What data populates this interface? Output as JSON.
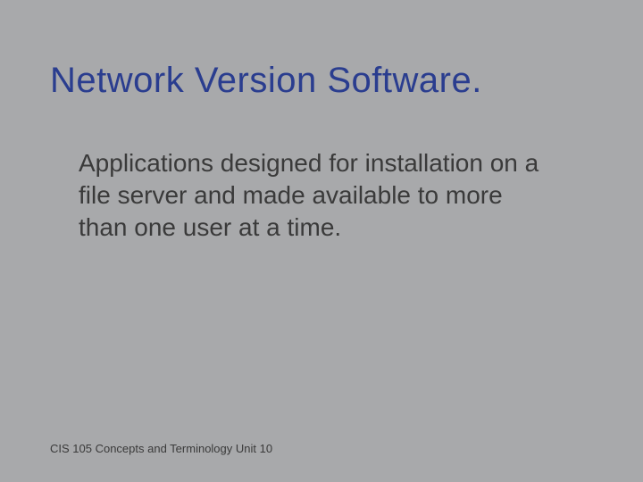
{
  "slide": {
    "title": "Network Version Software.",
    "body": "Applications designed for installation on a file server and made available to more than one user at a time.",
    "footer": "CIS 105 Concepts and Terminology  Unit 10"
  }
}
